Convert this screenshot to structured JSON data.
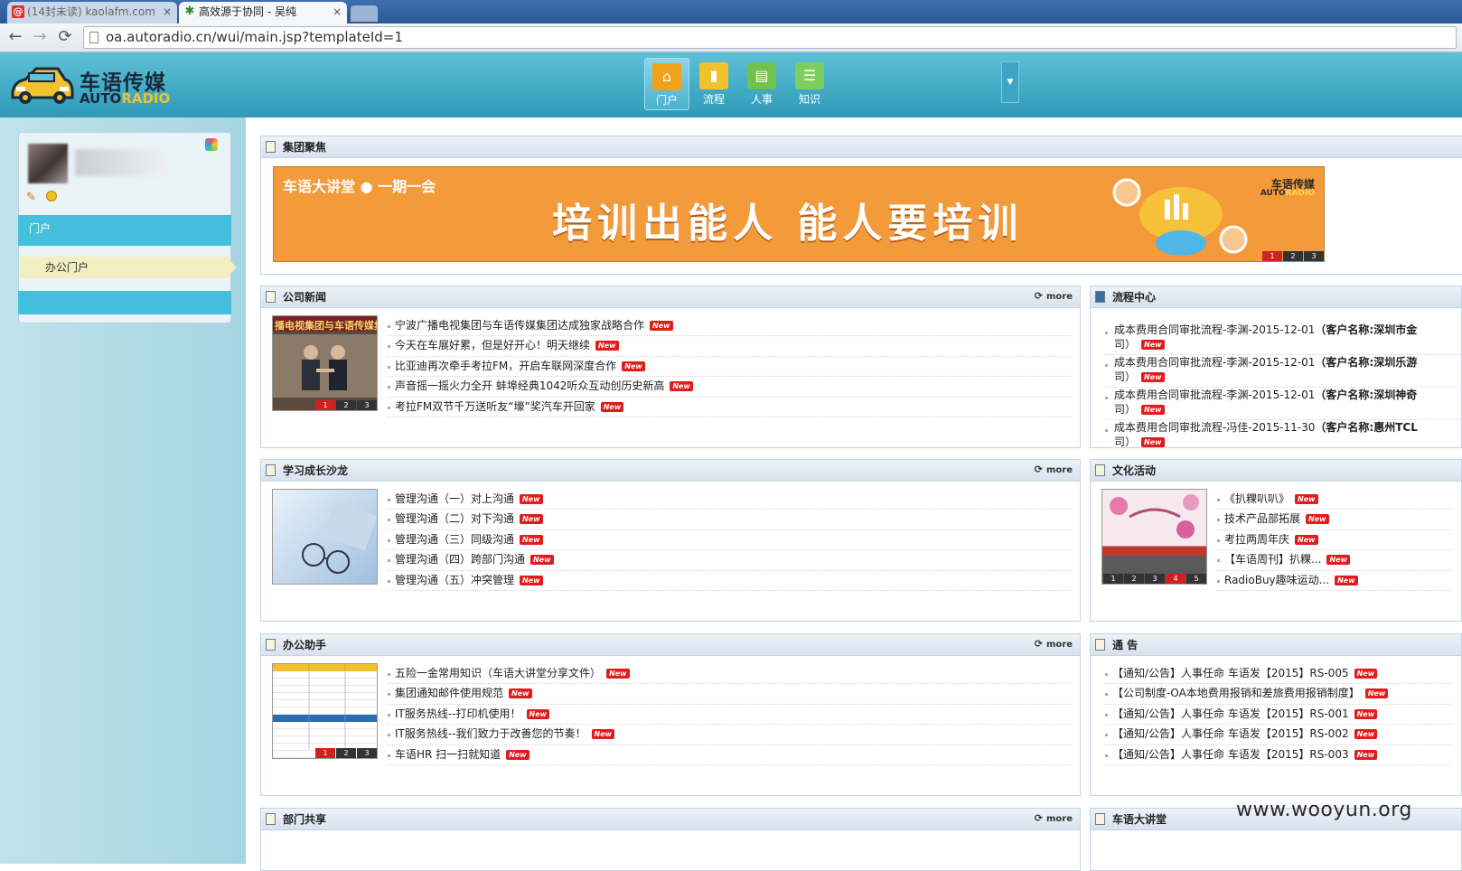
{
  "browser": {
    "tabs": [
      {
        "label": "(14封未读) kaolafm.com",
        "close": "×"
      },
      {
        "label": "高效源于协同 - 吴纯",
        "close": "×"
      }
    ],
    "url": "oa.autoradio.cn/wui/main.jsp?templateId=1",
    "nav": {
      "back": "←",
      "forward": "→",
      "reload": "⟳"
    }
  },
  "header": {
    "logo_cn": "车语传媒",
    "logo_en_a": "AUTO",
    "logo_en_b": "RADIO",
    "modules": [
      {
        "label": "门户",
        "icon": "home-icon",
        "color": "#f2a21a",
        "glyph": "⌂"
      },
      {
        "label": "流程",
        "icon": "chart-icon",
        "color": "#f2c12e",
        "glyph": "▮"
      },
      {
        "label": "人事",
        "icon": "id-card-icon",
        "color": "#6fc24a",
        "glyph": "▤"
      },
      {
        "label": "知识",
        "icon": "document-icon",
        "color": "#7ccf5c",
        "glyph": "☰"
      }
    ],
    "dropdown_glyph": "▼"
  },
  "sidebar": {
    "menu_portal": "门户",
    "menu_office": "办公门户",
    "edit_glyph": "✎"
  },
  "panels": {
    "focus": {
      "title": "集团聚焦",
      "banner_small": "车语大讲堂 ● 一期一会",
      "banner_main": "培训出能人  能人要培训",
      "banner_logo_cn": "车语传媒",
      "banner_logo_en_a": "AUTO",
      "banner_logo_en_b": "RADIO",
      "pager": [
        "1",
        "2",
        "3"
      ]
    },
    "company_news": {
      "title": "公司新闻",
      "more": "more",
      "thumb_caption": "播电视集团与车语传媒集团合作",
      "pager": [
        "1",
        "2",
        "3"
      ],
      "items": [
        "宁波广播电视集团与车语传媒集团达成独家战略合作",
        "今天在车展好累，但是好开心！明天继续",
        "比亚迪再次牵手考拉FM，开启车联网深度合作",
        "声音摇一摇火力全开 蚌埠经典1042听众互动创历史新高",
        "考拉FM双节千万送听友“壕”奖汽车开回家"
      ]
    },
    "flow_center": {
      "title": "流程中心",
      "items": [
        {
          "text": "成本费用合同审批流程-李渊-2015-12-01",
          "client": "（客户名称:深圳市金",
          "suffix": "司）"
        },
        {
          "text": "成本费用合同审批流程-李渊-2015-12-01",
          "client": "（客户名称:深圳乐游",
          "suffix": "司）"
        },
        {
          "text": "成本费用合同审批流程-李渊-2015-12-01",
          "client": "（客户名称:深圳神奇",
          "suffix": "司）"
        },
        {
          "text": "成本费用合同审批流程-冯佳-2015-11-30",
          "client": "（客户名称:惠州TCL",
          "suffix": "司）"
        }
      ]
    },
    "learning": {
      "title": "学习成长沙龙",
      "more": "more",
      "items": [
        "管理沟通（一）对上沟通",
        "管理沟通（二）对下沟通",
        "管理沟通（三）同级沟通",
        "管理沟通（四）跨部门沟通",
        "管理沟通（五）冲突管理"
      ]
    },
    "culture": {
      "title": "文化活动",
      "pager": [
        "1",
        "2",
        "3",
        "4",
        "5"
      ],
      "items": [
        "《扒粿叭叭》",
        "技术产品部拓展",
        "考拉两周年庆",
        "【车语周刊】扒粿...",
        "RadioBuy趣味运动..."
      ]
    },
    "office_helper": {
      "title": "办公助手",
      "more": "more",
      "pager": [
        "1",
        "2",
        "3"
      ],
      "items": [
        "五险一金常用知识（车语大讲堂分享文件）",
        "集团通知邮件使用规范",
        "IT服务热线--打印机使用！",
        "IT服务热线--我们致力于改善您的节奏！",
        "车语HR 扫一扫就知道"
      ]
    },
    "notice": {
      "title": "通 告",
      "items": [
        "【通知/公告】人事任命 车语发【2015】RS-005",
        "【公司制度-OA本地费用报销和差旅费用报销制度】",
        "【通知/公告】人事任命 车语发【2015】RS-001",
        "【通知/公告】人事任命 车语发【2015】RS-002",
        "【通知/公告】人事任命 车语发【2015】RS-003"
      ]
    },
    "dept_share": {
      "title": "部门共享",
      "more": "more"
    },
    "lecture": {
      "title": "车语大讲堂"
    }
  },
  "badge_text": "New",
  "refresh_glyph": "⟳",
  "watermark": "www.wooyun.org"
}
